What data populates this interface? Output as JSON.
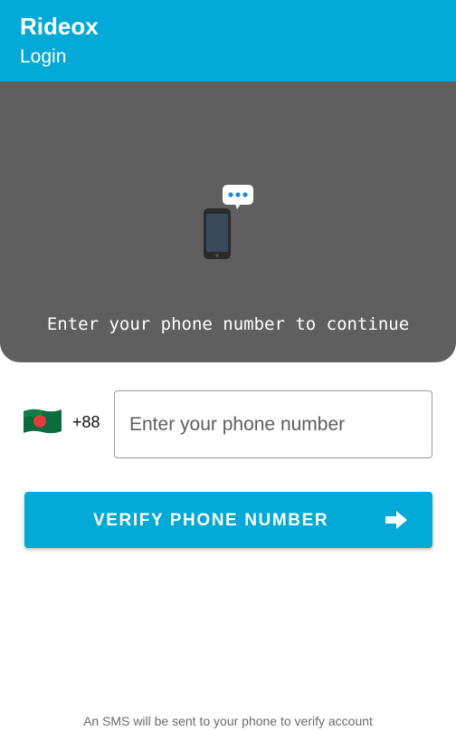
{
  "app": {
    "title": "Rideox",
    "subtitle": "Login",
    "accent_color": "#00a9d6"
  },
  "hero": {
    "message": "Enter your phone number to continue",
    "background_color": "#5f5f5f",
    "icons": [
      "smartphone-icon",
      "chat-bubble-icon"
    ]
  },
  "phone_form": {
    "country_flag_icon": "bangladesh-flag-icon",
    "country_code": "+88",
    "input_value": "",
    "input_placeholder": "Enter your phone number"
  },
  "verify_button": {
    "label": "VERIFY PHONE NUMBER",
    "icon": "arrow-right-icon"
  },
  "footer": {
    "note": "An SMS will be sent to your phone to verify account"
  }
}
